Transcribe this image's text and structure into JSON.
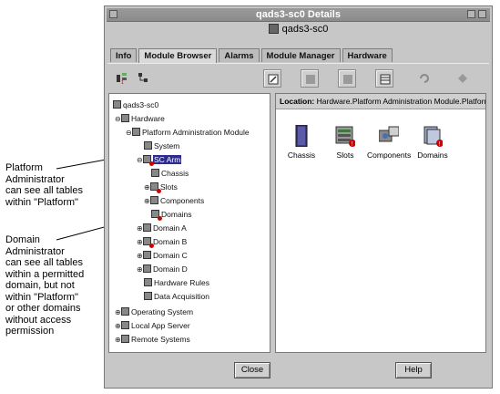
{
  "annotations": {
    "platform": "Platform\nAdministrator\ncan see all tables\nwithin  \"Platform\"",
    "domain": "Domain\nAdministrator\ncan see all tables\nwithin a permitted\ndomain, but not\nwithin  \"Platform\"\nor other domains\nwithout access\npermission"
  },
  "window": {
    "title": "qads3-sc0 Details",
    "host": "qads3-sc0"
  },
  "tabs": [
    "Info",
    "Module Browser",
    "Alarms",
    "Module Manager",
    "Hardware"
  ],
  "tree": [
    "qads3-sc0",
    "Hardware",
    "Platform Administration Module",
    "System",
    "SC Arm",
    "Chassis",
    "Slots",
    "Components",
    "Domains",
    "Domain A",
    "Domain B",
    "Domain C",
    "Domain D",
    "Hardware Rules",
    "Data Acquisition",
    "Operating System",
    "Local App Server",
    "Remote Systems"
  ],
  "location": {
    "label": "Location:",
    "value": "Hardware.Platform Administration Module.Platform"
  },
  "objects": [
    "Chassis",
    "Slots",
    "Components",
    "Domains"
  ],
  "buttons": {
    "close": "Close",
    "help": "Help"
  },
  "colors": {
    "window_bg": "#c7c7c7",
    "selection": "#2d2d8f",
    "alarm": "#d20000"
  }
}
